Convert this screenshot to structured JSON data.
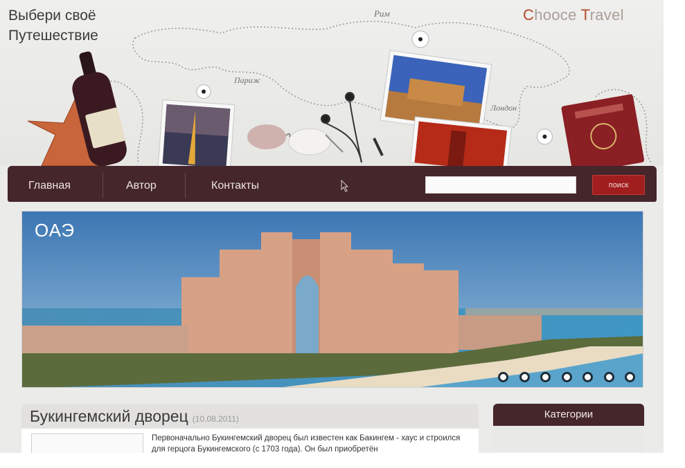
{
  "header": {
    "tagline_line1": "Выбери своё",
    "tagline_line2": "Путешествие",
    "logo_first_letter": "C",
    "logo_middle": "hooce ",
    "logo_second_letter": "T",
    "logo_rest": "ravel",
    "map_labels": [
      "Рим",
      "Париж",
      "Лондон"
    ]
  },
  "nav": {
    "items": [
      {
        "label": "Главная"
      },
      {
        "label": "Автор"
      },
      {
        "label": "Контакты"
      }
    ],
    "search_value": "",
    "search_button": "поиск"
  },
  "slider": {
    "caption": "ОАЭ",
    "dot_count": 7
  },
  "article": {
    "title": "Букингемский дворец",
    "date": "(10.08.2011)",
    "text": "Первоначально Букингемский дворец был известен как Бакингем - хаус и строился для герцога Букингемского (с 1703 года). Он был приобретён"
  },
  "sidebar": {
    "title": "Категории"
  },
  "colors": {
    "nav_background": "#45262a",
    "search_button": "#a11e1e",
    "logo_accent": "#b64a2a",
    "page_background": "#ebebe9"
  }
}
